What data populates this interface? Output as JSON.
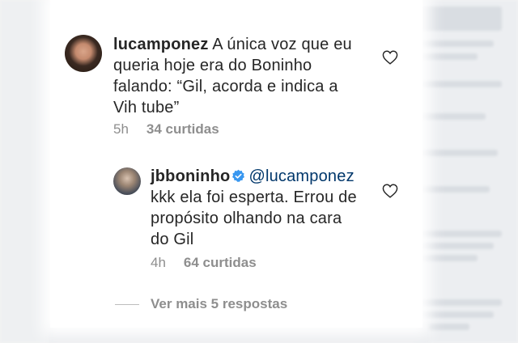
{
  "comments": [
    {
      "username": "lucamponez",
      "text": "A única voz que eu queria hoje era do Boninho falando: “Gil, acorda e indica a Vih tube”",
      "time": "5h",
      "likes": "34 curtidas"
    },
    {
      "username": "jbboninho",
      "mention": "@lucamponez",
      "text": "kkk ela foi esperta. Errou de propósito olhando na cara do Gil",
      "time": "4h",
      "likes": "64 curtidas"
    }
  ],
  "view_more": "Ver mais 5 respostas",
  "icons": {
    "like": "heart-outline-icon",
    "verified": "verified-badge-icon"
  },
  "colors": {
    "text": "#262626",
    "meta": "#8e8e8e",
    "mention": "#00376b",
    "verified": "#3897f0"
  }
}
